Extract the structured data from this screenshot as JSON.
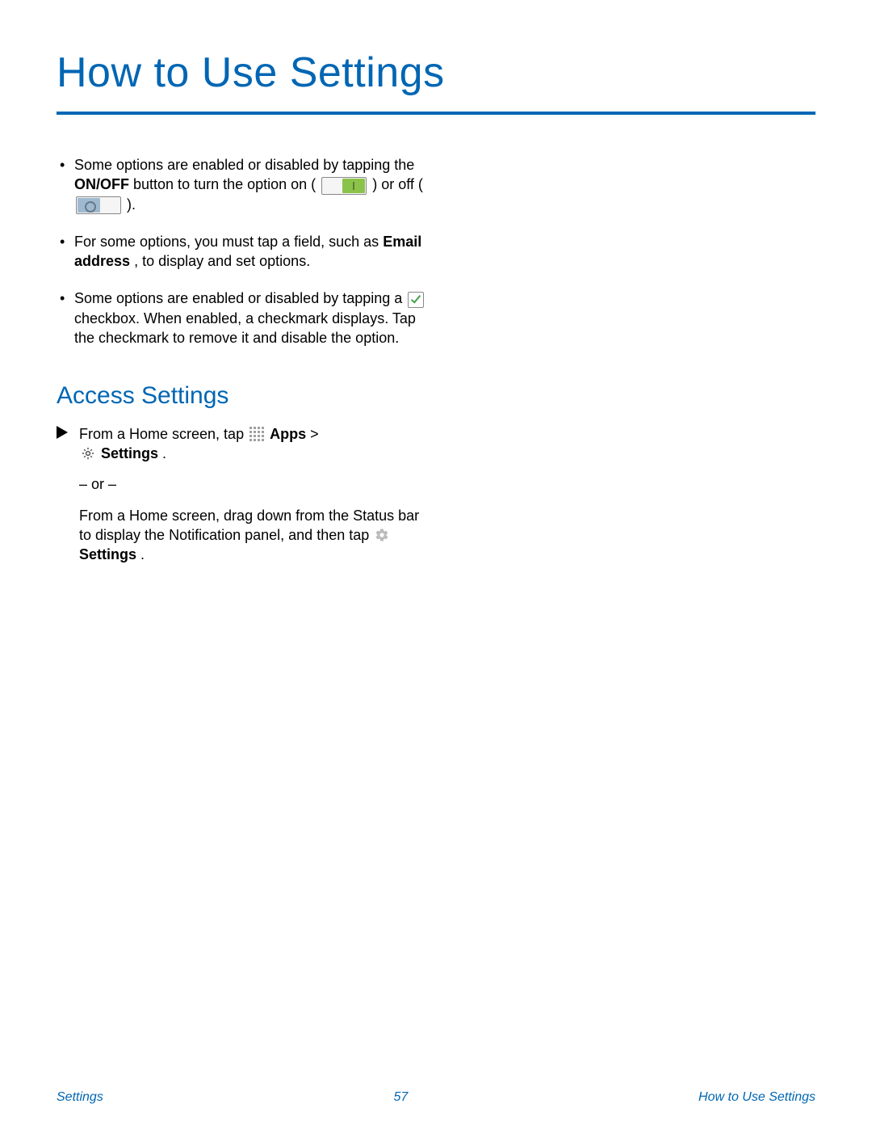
{
  "title": "How to Use Settings",
  "bullets": {
    "b1": {
      "pre": "Some options are enabled or disabled by tapping the ",
      "onoff": "ON/OFF",
      "mid1": " button to turn the option on ( ",
      "mid2": " ) or off ( ",
      "post": " )."
    },
    "b2": {
      "pre": "For some options, you must tap a field, such as ",
      "emph": "Email address",
      "post": ", to display and set options."
    },
    "b3": {
      "pre": "Some options are enabled or disabled by tapping a ",
      "post": " checkbox. When enabled, a checkmark displays. Tap the checkmark to remove it and disable the option."
    }
  },
  "subhead": "Access Settings",
  "step": {
    "line1_pre": "From a Home screen, tap ",
    "apps_label": "Apps",
    "gt": "  >",
    "settings_label": "Settings",
    "period": " .",
    "or": "– or –",
    "line2": "From a Home screen, drag down from the Status bar to display the Notification panel, and then tap "
  },
  "footer": {
    "left": "Settings",
    "center": "57",
    "right": "How to Use Settings"
  }
}
